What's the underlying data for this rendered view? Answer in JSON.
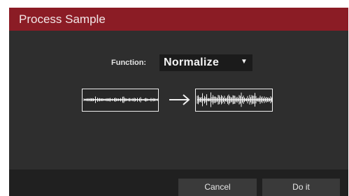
{
  "dialog": {
    "title": "Process Sample",
    "function_label": "Function:",
    "function_value": "Normalize",
    "cancel_label": "Cancel",
    "do_it_label": "Do it"
  },
  "icons": {
    "dropdown": "caret-down-icon",
    "arrow": "right-arrow-icon",
    "input_wave": "waveform-before-icon",
    "output_wave": "waveform-normalized-icon"
  },
  "colors": {
    "title_bar": "#8b1c25",
    "dialog_bg": "#2e2e2e",
    "footer_bg": "#202020",
    "button_bg": "#3a3a3a"
  }
}
